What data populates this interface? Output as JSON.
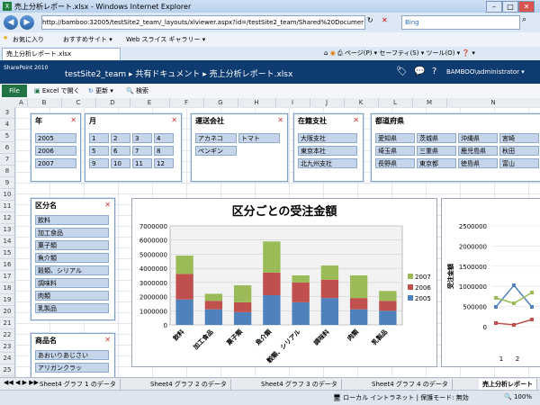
{
  "window": {
    "title": "売上分析レポート.xlsx - Windows Internet Explorer",
    "min": "–",
    "max": "□",
    "close": "✕"
  },
  "address": {
    "url": "http://bamboo:32005/testSite2_team/_layouts/xlviewer.aspx?id=/testSite2_team/Shared%20Documer",
    "search_placeholder": "Bing"
  },
  "favorites": {
    "label": "お気に入り",
    "item1": "おすすめサイト ▾",
    "item2": "Web スライス ギャラリー ▾"
  },
  "browser_tab": "売上分析レポート.xlsx",
  "tools": {
    "page": "ページ(P) ▾",
    "safety": "セーフティ(S) ▾",
    "tool": "ツール(O) ▾",
    "help": "❓ ▾"
  },
  "sharepoint": {
    "logo": "SharePoint 2010",
    "breadcrumb": "testSite2_team ▸ 共有ドキュメント ▸ 売上分析レポート.xlsx",
    "user": "BAMBOO\\administrator ▾"
  },
  "ribbon": {
    "file": "File",
    "open_excel": "Excel で開く",
    "refresh": "更新 ▾",
    "find": "検索"
  },
  "columns": [
    "A",
    "B",
    "C",
    "D",
    "E",
    "F",
    "G",
    "H",
    "I",
    "J",
    "K",
    "L",
    "M",
    "N"
  ],
  "rows": [
    "3",
    "4",
    "5",
    "6",
    "7",
    "8",
    "9",
    "10",
    "11",
    "12",
    "13",
    "14",
    "15",
    "16",
    "17",
    "18",
    "19",
    "20",
    "21",
    "22",
    "23",
    "24",
    "25"
  ],
  "slicers": {
    "year": {
      "title": "年",
      "items": [
        "2005",
        "2006",
        "2007"
      ]
    },
    "month": {
      "title": "月",
      "items": [
        "1",
        "2",
        "3",
        "4",
        "5",
        "6",
        "7",
        "8",
        "9",
        "10",
        "11",
        "12"
      ]
    },
    "shipper": {
      "title": "運送会社",
      "items": [
        "アカネコ",
        "トマト",
        "ペンギン"
      ]
    },
    "branch": {
      "title": "在籍支社",
      "items": [
        "大阪支社",
        "東京本社",
        "北九州支社"
      ]
    },
    "pref": {
      "title": "都道府県",
      "items": [
        "愛知県",
        "茨城県",
        "沖縄県",
        "宮崎",
        "埼玉県",
        "三重県",
        "鹿児島県",
        "秋田",
        "長野県",
        "東京都",
        "徳島県",
        "富山"
      ]
    },
    "category": {
      "title": "区分名",
      "items": [
        "飲料",
        "加工食品",
        "菓子類",
        "魚介類",
        "穀類、シリアル",
        "調味料",
        "肉類",
        "乳製品"
      ]
    },
    "product": {
      "title": "商品名",
      "items": [
        "あおいりあじさい",
        "アリガンクラッ"
      ]
    }
  },
  "chart_data": [
    {
      "type": "bar",
      "title": "区分ごとの受注金額",
      "categories": [
        "飲料",
        "加工食品",
        "菓子類",
        "魚介類",
        "穀類、シリアル",
        "調味料",
        "肉類",
        "乳製品"
      ],
      "series": [
        {
          "name": "2005",
          "values": [
            1800000,
            1100000,
            900000,
            2100000,
            1600000,
            1900000,
            1100000,
            1000000
          ]
        },
        {
          "name": "2006",
          "values": [
            1800000,
            600000,
            700000,
            1600000,
            1400000,
            1300000,
            800000,
            700000
          ]
        },
        {
          "name": "2007",
          "values": [
            1300000,
            500000,
            1200000,
            2200000,
            500000,
            1000000,
            1600000,
            700000
          ]
        }
      ],
      "ylim": [
        0,
        7000000
      ],
      "yticks": [
        "7000000",
        "6000000",
        "5000000",
        "4000000",
        "3000000",
        "2000000",
        "1000000",
        "0"
      ],
      "legend": "right",
      "colors": {
        "2005": "#4f81bd",
        "2006": "#c0504d",
        "2007": "#9bbb59"
      }
    },
    {
      "type": "line",
      "ylabel": "受注金額",
      "ylim": [
        0,
        2500000
      ],
      "yticks": [
        "2500000",
        "2000000",
        "1500000",
        "1000000",
        "500000",
        "0"
      ],
      "xticks": [
        "1",
        "2"
      ],
      "series_colors": [
        "#4f81bd",
        "#c0504d",
        "#9bbb59"
      ]
    }
  ],
  "sheet_tabs": [
    "Sheet4 グラフ 1 のデータ",
    "Sheet4 グラフ 2 のデータ",
    "Sheet4 グラフ 3 のデータ",
    "Sheet4 グラフ 4 のデータ",
    "売上分析レポート"
  ],
  "status": {
    "zone": "ローカル イントラネット | 保護モード: 無効",
    "zoom": "100%"
  }
}
